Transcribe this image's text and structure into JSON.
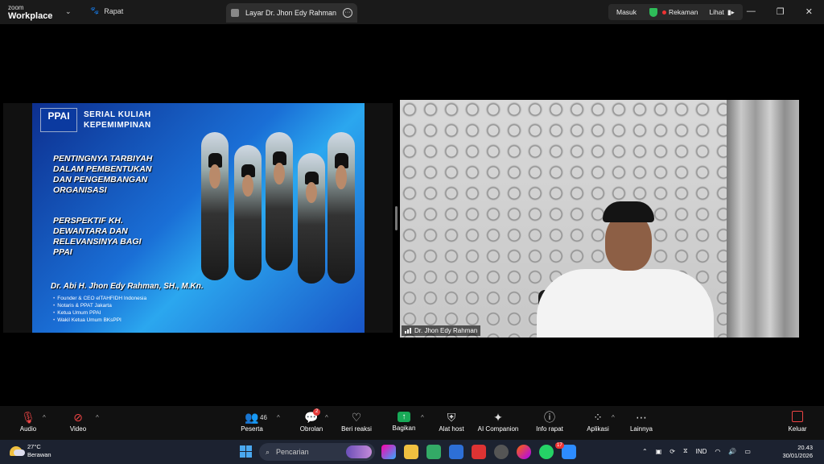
{
  "titlebar": {
    "brand_top": "zoom",
    "brand_bottom": "Workplace",
    "meeting_label": "Rapat",
    "tab_title": "Layar Dr. Jhon Edy Rahman",
    "signin": "Masuk",
    "recording": "Rekaman",
    "view": "Lihat"
  },
  "slide": {
    "logo": "PPAI",
    "series_line1": "SERIAL KULIAH",
    "series_line2": "KEPEMIMPINAN",
    "heading_lines": [
      "PENTINGNYA TARBIYAH",
      "DALAM PEMBENTUKAN",
      "DAN PENGEMBANGAN",
      "ORGANISASI"
    ],
    "heading2_lines": [
      "PERSPEKTIF KH.",
      "DEWANTARA DAN",
      "RELEVANSINYA BAGI",
      "PPAI"
    ],
    "author": "Dr. Abi H. Jhon Edy Rahman, SH., M.Kn.",
    "roles": [
      "Founder & CEO elTAHFIDH Indonesia",
      "Notaris & PPAT Jakarta",
      "Ketua Umum PPAI",
      "Wakil Ketua Umum BKsPPI"
    ]
  },
  "video": {
    "participant_name": "Dr. Jhon Edy Rahman"
  },
  "toolbar": {
    "audio": "Audio",
    "video": "Video",
    "participants": "Peserta",
    "participants_count": "46",
    "chat": "Obrolan",
    "chat_badge": "2",
    "reactions": "Beri reaksi",
    "share": "Bagikan",
    "host_tools": "Alat host",
    "ai": "AI Companion",
    "info": "Info rapat",
    "apps": "Aplikasi",
    "more": "Lainnya",
    "leave": "Keluar"
  },
  "taskbar": {
    "temperature": "27°C",
    "weather": "Berawan",
    "search_placeholder": "Pencarian",
    "whatsapp_badge": "17",
    "language": "IND",
    "time": "20.43",
    "date": "30/01/2026"
  }
}
